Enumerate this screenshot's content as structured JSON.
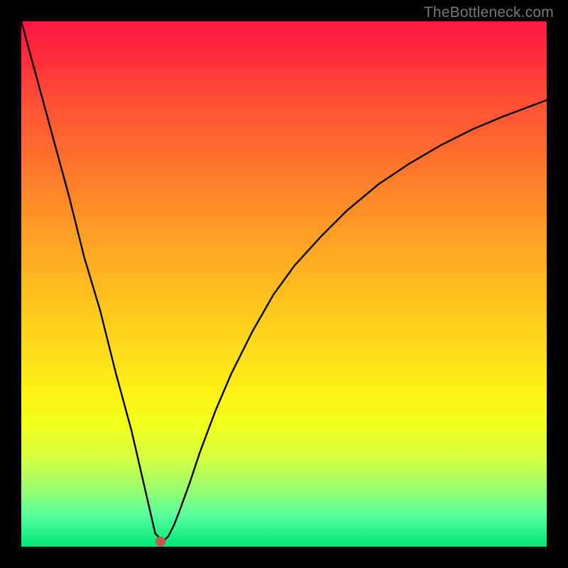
{
  "watermark": "TheBottleneck.com",
  "marker": {
    "color": "#c05a4a",
    "radius": 7
  },
  "chart_data": {
    "type": "line",
    "title": "",
    "xlabel": "",
    "ylabel": "",
    "xlim": [
      0,
      100
    ],
    "ylim": [
      0,
      100
    ],
    "grid": false,
    "legend": false,
    "series": [
      {
        "name": "bottleneck-curve",
        "x": [
          0,
          3,
          6,
          9,
          12,
          15,
          18,
          21,
          24,
          25.5,
          27,
          28,
          29,
          30,
          32,
          34,
          37,
          40,
          44,
          48,
          52,
          57,
          62,
          68,
          74,
          80,
          86,
          92,
          100
        ],
        "y": [
          100,
          89,
          78,
          67,
          55,
          45,
          33,
          22,
          9,
          2.5,
          1,
          2,
          4,
          6.5,
          12,
          18,
          26,
          33,
          41,
          48,
          53.5,
          59,
          64,
          69,
          73,
          76.5,
          79.5,
          82,
          85
        ]
      }
    ],
    "marker_point": {
      "x": 26.5,
      "y": 1
    }
  }
}
